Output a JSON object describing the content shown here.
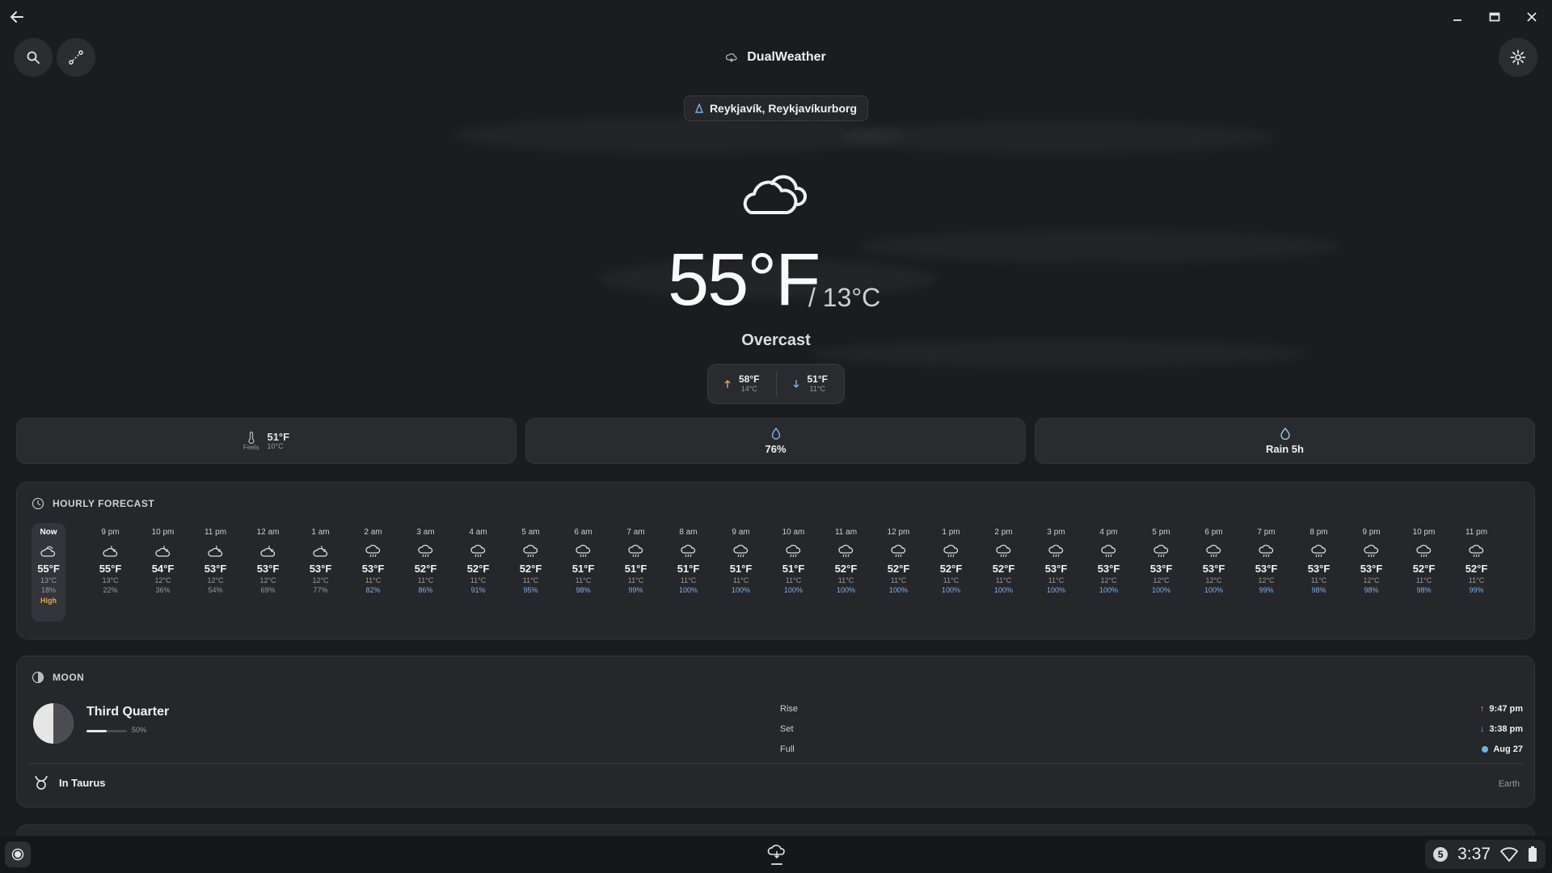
{
  "app": {
    "title": "DualWeather"
  },
  "location": {
    "name": "Reykjavík, Reykjavíkurborg"
  },
  "current": {
    "temp_f": "55°F",
    "temp_c": "/ 13°C",
    "condition": "Overcast",
    "high_f": "58°F",
    "high_c": "14°C",
    "low_f": "51°F",
    "low_c": "11°C"
  },
  "stats": {
    "feels_label": "Feels",
    "feels_f": "51°F",
    "feels_c": "10°C",
    "humidity": "76%",
    "rain": "Rain 5h"
  },
  "hourly": {
    "title": "HOURLY FORECAST",
    "items": [
      {
        "time": "Now",
        "icon": "cloud-sun-icon",
        "f": "55°F",
        "c": "13°C",
        "p": "18%",
        "note": "High"
      },
      {
        "time": "9 pm",
        "icon": "cloud-moon-icon",
        "f": "55°F",
        "c": "13°C",
        "p": "22%"
      },
      {
        "time": "10 pm",
        "icon": "cloud-moon-icon",
        "f": "54°F",
        "c": "12°C",
        "p": "36%"
      },
      {
        "time": "11 pm",
        "icon": "cloud-moon-icon",
        "f": "53°F",
        "c": "12°C",
        "p": "54%"
      },
      {
        "time": "12 am",
        "icon": "cloud-moon-icon",
        "f": "53°F",
        "c": "12°C",
        "p": "69%"
      },
      {
        "time": "1 am",
        "icon": "cloud-moon-icon",
        "f": "53°F",
        "c": "12°C",
        "p": "77%"
      },
      {
        "time": "2 am",
        "icon": "cloud-rain-icon",
        "f": "53°F",
        "c": "11°C",
        "p": "82%"
      },
      {
        "time": "3 am",
        "icon": "cloud-rain-icon",
        "f": "52°F",
        "c": "11°C",
        "p": "86%"
      },
      {
        "time": "4 am",
        "icon": "cloud-rain-icon",
        "f": "52°F",
        "c": "11°C",
        "p": "91%"
      },
      {
        "time": "5 am",
        "icon": "cloud-rain-icon",
        "f": "52°F",
        "c": "11°C",
        "p": "95%"
      },
      {
        "time": "6 am",
        "icon": "cloud-rain-icon",
        "f": "51°F",
        "c": "11°C",
        "p": "98%"
      },
      {
        "time": "7 am",
        "icon": "cloud-rain-icon",
        "f": "51°F",
        "c": "11°C",
        "p": "99%"
      },
      {
        "time": "8 am",
        "icon": "cloud-rain-icon",
        "f": "51°F",
        "c": "11°C",
        "p": "100%"
      },
      {
        "time": "9 am",
        "icon": "cloud-rain-icon",
        "f": "51°F",
        "c": "11°C",
        "p": "100%"
      },
      {
        "time": "10 am",
        "icon": "cloud-rain-icon",
        "f": "51°F",
        "c": "11°C",
        "p": "100%"
      },
      {
        "time": "11 am",
        "icon": "cloud-rain-icon",
        "f": "52°F",
        "c": "11°C",
        "p": "100%"
      },
      {
        "time": "12 pm",
        "icon": "cloud-rain-icon",
        "f": "52°F",
        "c": "11°C",
        "p": "100%"
      },
      {
        "time": "1 pm",
        "icon": "cloud-rain-icon",
        "f": "52°F",
        "c": "11°C",
        "p": "100%"
      },
      {
        "time": "2 pm",
        "icon": "cloud-rain-icon",
        "f": "52°F",
        "c": "11°C",
        "p": "100%"
      },
      {
        "time": "3 pm",
        "icon": "cloud-rain-icon",
        "f": "53°F",
        "c": "11°C",
        "p": "100%"
      },
      {
        "time": "4 pm",
        "icon": "cloud-rain-icon",
        "f": "53°F",
        "c": "12°C",
        "p": "100%"
      },
      {
        "time": "5 pm",
        "icon": "cloud-rain-icon",
        "f": "53°F",
        "c": "12°C",
        "p": "100%"
      },
      {
        "time": "6 pm",
        "icon": "cloud-rain-icon",
        "f": "53°F",
        "c": "12°C",
        "p": "100%"
      },
      {
        "time": "7 pm",
        "icon": "cloud-rain-icon",
        "f": "53°F",
        "c": "12°C",
        "p": "99%"
      },
      {
        "time": "8 pm",
        "icon": "cloud-rain-icon",
        "f": "53°F",
        "c": "11°C",
        "p": "98%"
      },
      {
        "time": "9 pm",
        "icon": "cloud-rain-icon",
        "f": "53°F",
        "c": "12°C",
        "p": "98%"
      },
      {
        "time": "10 pm",
        "icon": "cloud-rain-icon",
        "f": "52°F",
        "c": "11°C",
        "p": "98%"
      },
      {
        "time": "11 pm",
        "icon": "cloud-rain-icon",
        "f": "52°F",
        "c": "11°C",
        "p": "99%"
      }
    ]
  },
  "moon": {
    "title": "MOON",
    "phase": "Third Quarter",
    "illumination": "50%",
    "illumination_fraction": 0.5,
    "rise_label": "Rise",
    "rise": "9:47 pm",
    "set_label": "Set",
    "set": "3:38 pm",
    "full_label": "Full",
    "full": "Aug 27",
    "sign": "In Taurus",
    "element": "Earth"
  },
  "taskbar": {
    "badge": "5",
    "clock": "3:37"
  },
  "colors": {
    "accent_blue": "#7fb0e8",
    "high_orange": "#e3a65b",
    "rise_orange": "#e3a65b",
    "full_dot": "#6fb3e6"
  }
}
